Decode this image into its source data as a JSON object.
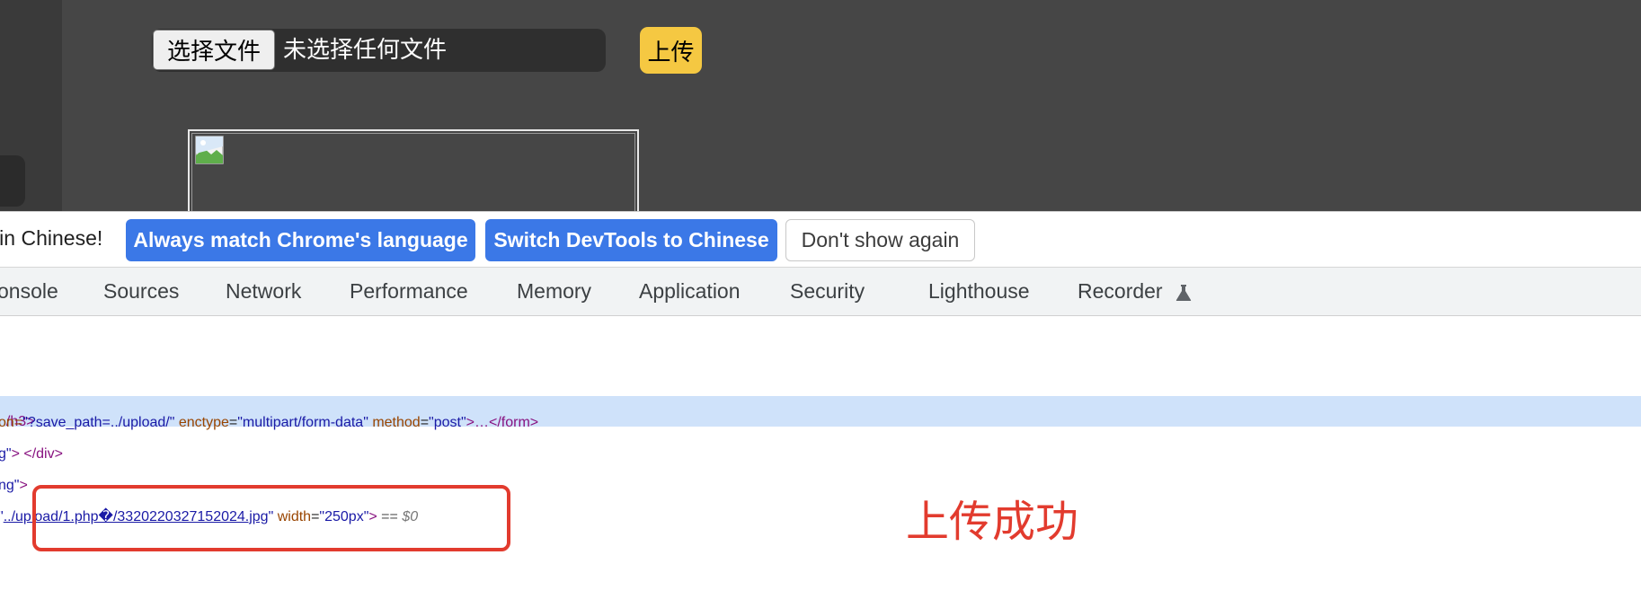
{
  "page": {
    "choose_file_label": "选择文件",
    "no_file_text": "未选择任何文件",
    "upload_label": "上传"
  },
  "devtools": {
    "infobar": {
      "message": "e in Chinese!",
      "always_match": "Always match Chrome's language",
      "switch_chinese": "Switch DevTools to Chinese",
      "dont_show": "Don't show again"
    },
    "tabs": [
      "onsole",
      "Sources",
      "Network",
      "Performance",
      "Memory",
      "Application",
      "Security",
      "Lighthouse",
      "Recorder"
    ],
    "code": {
      "line1": "/h3>",
      "line2_attr_tail": "on=",
      "line2_action_val": "\"?save_path=../upload/\"",
      "line2_enctype": "enctype",
      "line2_enctype_val": "\"multipart/form-data\"",
      "line2_method": "method",
      "line2_method_val": "\"post\"",
      "line2_end": ">…</form>",
      "line3_val": "g\"",
      "line3_end": "> </div>",
      "line4_val": "ng\"",
      "line4_end": ">",
      "line5_quote_open": "\"",
      "line5_link": "../upload/1.php�/3320220327152024.jpg",
      "line5_quote_close": "\"",
      "line5_width_attr": "width",
      "line5_width_val": "\"250px\"",
      "line5_close": ">",
      "line5_eq": "==",
      "line5_dollar": "$0"
    }
  },
  "annotation": {
    "text": "上传成功",
    "color": "#e23b2e"
  },
  "colors": {
    "accent_blue": "#3b78e7",
    "upload_yellow": "#f5c842",
    "selection_blue": "#cfe2fa"
  }
}
